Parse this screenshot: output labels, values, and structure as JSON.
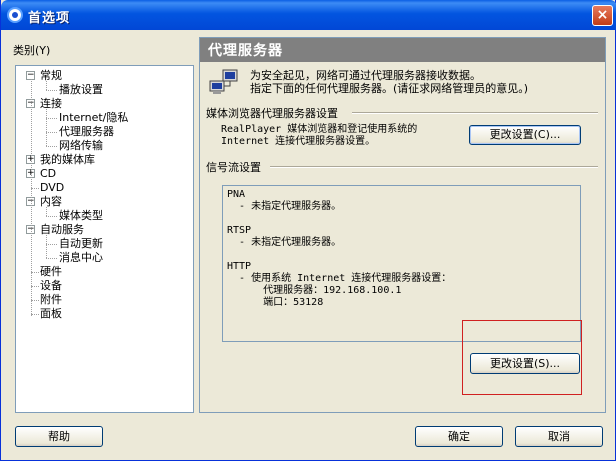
{
  "window": {
    "title": "首选项",
    "close_label": "×"
  },
  "sidebar": {
    "category_label": "类别(Y)",
    "items": [
      {
        "label": "常规",
        "level": 0,
        "expander": "−"
      },
      {
        "label": "播放设置",
        "level": 1
      },
      {
        "label": "连接",
        "level": 0,
        "expander": "−"
      },
      {
        "label": "Internet/隐私",
        "level": 1
      },
      {
        "label": "代理服务器",
        "level": 1
      },
      {
        "label": "网络传输",
        "level": 1
      },
      {
        "label": "我的媒体库",
        "level": 0,
        "expander": "+"
      },
      {
        "label": "CD",
        "level": 0,
        "expander": "+"
      },
      {
        "label": "DVD",
        "level": 0
      },
      {
        "label": "内容",
        "level": 0,
        "expander": "−"
      },
      {
        "label": "媒体类型",
        "level": 1
      },
      {
        "label": "自动服务",
        "level": 0,
        "expander": "−"
      },
      {
        "label": "自动更新",
        "level": 1
      },
      {
        "label": "消息中心",
        "level": 1
      },
      {
        "label": "硬件",
        "level": 0
      },
      {
        "label": "设备",
        "level": 0
      },
      {
        "label": "附件",
        "level": 0
      },
      {
        "label": "面板",
        "level": 0
      }
    ]
  },
  "panel": {
    "header": "代理服务器",
    "intro_line1": "为安全起见，网络可通过代理服务器接收数据。",
    "intro_line2": "指定下面的任何代理服务器。(请征求网络管理员的意见。)",
    "browser_section": {
      "title": "媒体浏览器代理服务器设置",
      "desc_line1": "RealPlayer 媒体浏览器和登记使用系统的",
      "desc_line2": "Internet 连接代理服务器设置。",
      "button": "更改设置(C)..."
    },
    "stream_section": {
      "title": "信号流设置",
      "lines": [
        "PNA",
        "  - 未指定代理服务器。",
        "",
        "RTSP",
        "  - 未指定代理服务器。",
        "",
        "HTTP",
        "  - 使用系统 Internet 连接代理服务器设置：",
        "      代理服务器：192.168.100.1",
        "      端口：53128"
      ],
      "button": "更改设置(S)..."
    }
  },
  "footer": {
    "help": "帮助",
    "ok": "确定",
    "cancel": "取消"
  }
}
